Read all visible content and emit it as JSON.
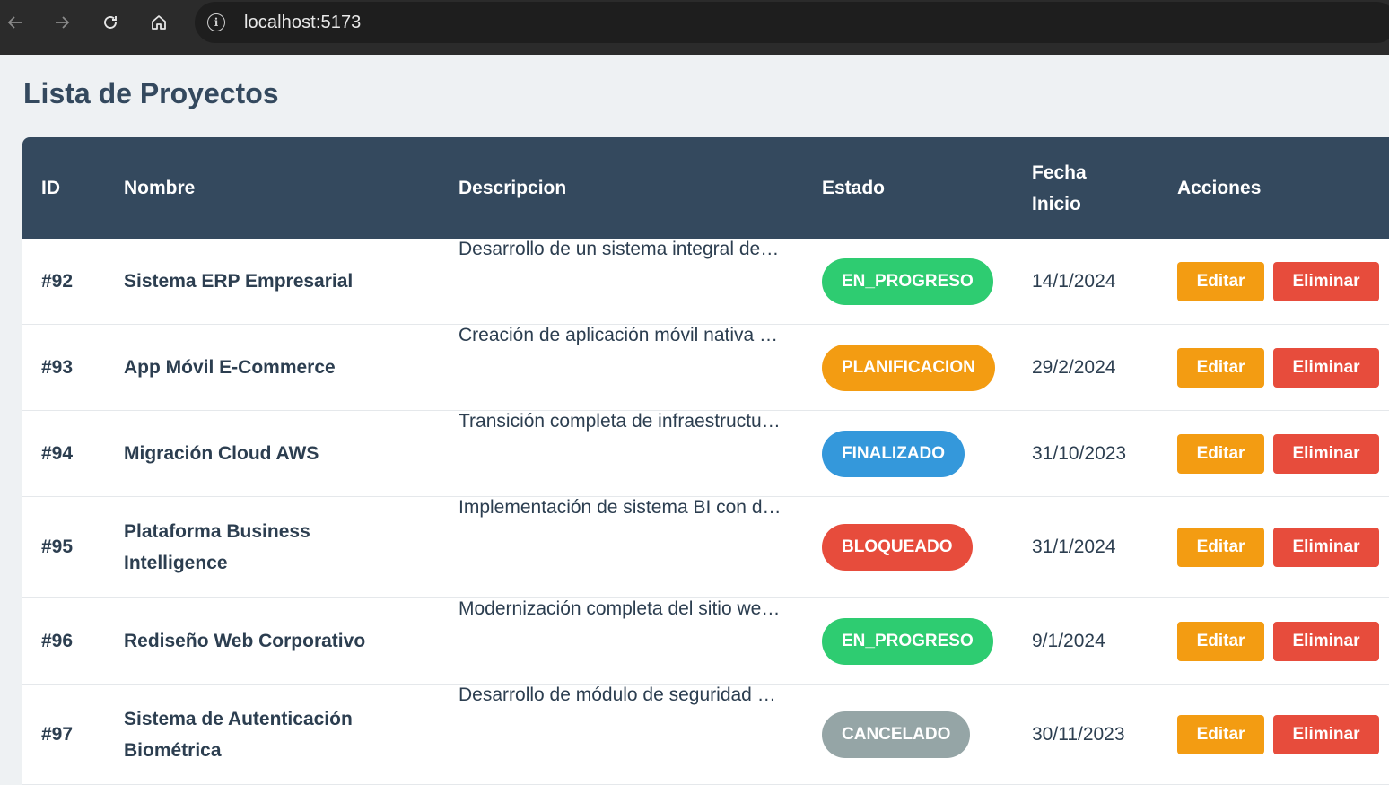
{
  "browser": {
    "url": "localhost:5173",
    "info_glyph": "i"
  },
  "page": {
    "title": "Lista de Proyectos"
  },
  "table": {
    "headers": {
      "id": "ID",
      "nombre": "Nombre",
      "descripcion": "Descripcion",
      "estado": "Estado",
      "fecha_line1": "Fecha",
      "fecha_line2": "Inicio",
      "acciones": "Acciones"
    },
    "rows": [
      {
        "id": "#92",
        "name_line1": "Sistema ERP Empresarial",
        "name_line2": "",
        "desc": "Desarrollo de un sistema integral de gestión empresarial",
        "estado": "EN_PROGRESO",
        "estado_color": "#2ecc71",
        "fecha": "14/1/2024",
        "edit": "Editar",
        "delete": "Eliminar"
      },
      {
        "id": "#93",
        "name_line1": "App Móvil E-Commerce",
        "name_line2": "",
        "desc": "Creación de aplicación móvil nativa para comercio electrónico",
        "estado": "PLANIFICACION",
        "estado_color": "#f39c12",
        "fecha": "29/2/2024",
        "edit": "Editar",
        "delete": "Eliminar"
      },
      {
        "id": "#94",
        "name_line1": "Migración Cloud AWS",
        "name_line2": "",
        "desc": "Transición completa de infraestructura a la nube",
        "estado": "FINALIZADO",
        "estado_color": "#3498db",
        "fecha": "31/10/2023",
        "edit": "Editar",
        "delete": "Eliminar"
      },
      {
        "id": "#95",
        "name_line1": "Plataforma Business",
        "name_line2": "Intelligence",
        "desc": "Implementación de sistema BI con dashboards",
        "estado": "BLOQUEADO",
        "estado_color": "#e74c3c",
        "fecha": "31/1/2024",
        "edit": "Editar",
        "delete": "Eliminar"
      },
      {
        "id": "#96",
        "name_line1": "Rediseño Web Corporativo",
        "name_line2": "",
        "desc": "Modernización completa del sitio web corporativo",
        "estado": "EN_PROGRESO",
        "estado_color": "#2ecc71",
        "fecha": "9/1/2024",
        "edit": "Editar",
        "delete": "Eliminar"
      },
      {
        "id": "#97",
        "name_line1": "Sistema de Autenticación",
        "name_line2": "Biométrica",
        "desc": "Desarrollo de módulo de seguridad biométrica",
        "estado": "CANCELADO",
        "estado_color": "#95a5a6",
        "fecha": "30/11/2023",
        "edit": "Editar",
        "delete": "Eliminar"
      }
    ]
  }
}
